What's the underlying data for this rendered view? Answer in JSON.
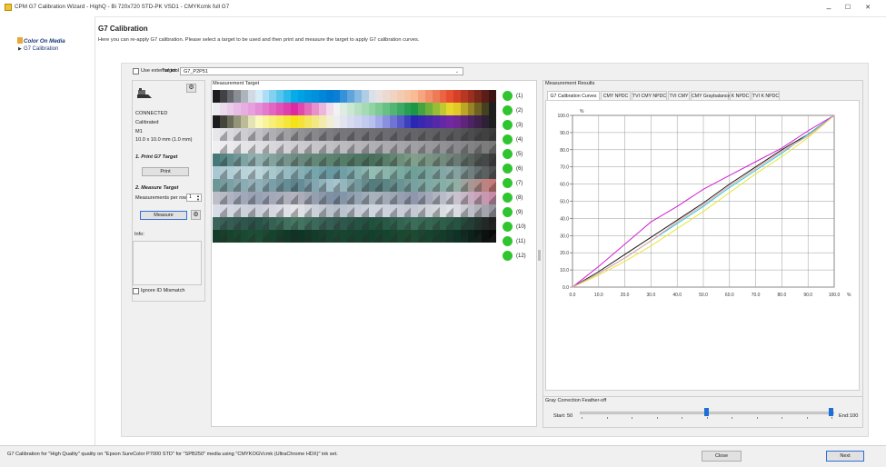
{
  "window": {
    "title": "CPM G7 Calibration Wizard - HighQ - Bi 720x720 STD-PK VSD1 - CMYKcmk full G7",
    "minimize": "–",
    "maximize": "☐",
    "close": "✕"
  },
  "nav": {
    "media_label": "Color On Media",
    "g7_label": "G7 Calibration",
    "arrow": "▶"
  },
  "header": {
    "title": "G7 Calibration",
    "description": "Here you can re-apply G7 calibration.  Please select a target to be used and then print and measure the target to apply G7 calibration curves."
  },
  "controls": {
    "use_external_tool": "Use external tool",
    "target_label": "Target:",
    "target_value": "G7_P2P51",
    "chevron": "⌄"
  },
  "left_panel": {
    "status": "CONNECTED",
    "calibrated": "Calibrated",
    "mode": "M1",
    "aperture": "10.0 x 10.0 mm (1.0 mm)",
    "print_section": "1. Print G7 Target",
    "print_button": "Print",
    "measure_section": "2. Measure Target",
    "measurements_per_row_label": "Measurements per row",
    "measurements_per_row_value": "1",
    "measure_button": "Measure",
    "info_label": "Info:",
    "ignore_id_mismatch": "Ignore ID Mismatch"
  },
  "measurement_target": {
    "header": "Measurement Target",
    "row_labels": [
      "(1)",
      "(2)",
      "(3)",
      "(4)",
      "(5)",
      "(6)",
      "(7)",
      "(8)",
      "(9)",
      "(10)",
      "(11)",
      "(12)"
    ],
    "status_color": "#2fc52f"
  },
  "measurement_results": {
    "header": "Measurement Results",
    "tabs": [
      "G7 Calibration Curves",
      "CMY NPDC",
      "TVI CMY NPDC",
      "TVI CMY",
      "CMY Graybalance",
      "K NPDC",
      "TVI K NPDC"
    ],
    "active_tab": 0
  },
  "chart_data": {
    "type": "line",
    "y_unit": "%",
    "x_unit": "%",
    "xlim": [
      0,
      100
    ],
    "ylim": [
      0,
      100
    ],
    "x_ticks": [
      "0.0",
      "10.0",
      "20.0",
      "30.0",
      "40.0",
      "50.0",
      "60.0",
      "70.0",
      "80.0",
      "90.0",
      "100.0"
    ],
    "y_ticks": [
      "0.0",
      "10.0",
      "20.0",
      "30.0",
      "40.0",
      "50.0",
      "60.0",
      "70.0",
      "80.0",
      "90.0",
      "100.0"
    ],
    "grid": true,
    "x": [
      0,
      10,
      20,
      30,
      40,
      50,
      60,
      70,
      80,
      90,
      100
    ],
    "series": [
      {
        "color": "#d21fd2",
        "values": [
          0,
          12,
          25,
          38,
          47,
          57,
          65,
          73,
          81,
          91,
          100
        ]
      },
      {
        "color": "#1a1a1a",
        "values": [
          0,
          9,
          19,
          29,
          39,
          49,
          60,
          70,
          80,
          89,
          100
        ]
      },
      {
        "color": "#22c8d8",
        "values": [
          0,
          8,
          17,
          27,
          37,
          47,
          58,
          68,
          78,
          89,
          100
        ]
      },
      {
        "color": "#e5e53a",
        "values": [
          0,
          7,
          15,
          24,
          34,
          44,
          55,
          66,
          76,
          87,
          100
        ]
      },
      {
        "color": "#f0a0a0",
        "values": [
          0,
          8,
          17,
          27,
          38,
          48,
          59,
          69,
          79,
          88,
          100
        ]
      }
    ]
  },
  "gray_correction": {
    "title": "Gray Correction Feather-off",
    "start_label": "Start:",
    "start_value": "50",
    "end_label": "End:",
    "end_value": "100"
  },
  "status_bar": {
    "text": "G7 Calibration for \"High Quality\" quality on \"Epson SureColor P7000 STD\" for \"SPB250\" media using \"CMYKOGVcmk (UltraChrome HDX)\" ink set.",
    "close_button": "Close",
    "next_button": "Next"
  }
}
